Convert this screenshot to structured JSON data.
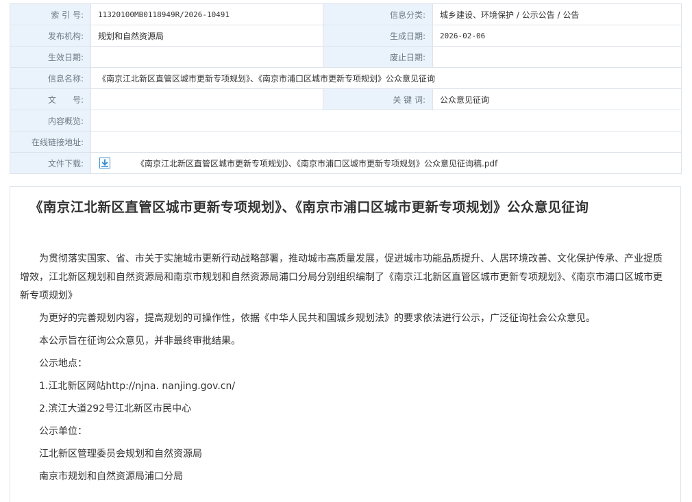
{
  "meta": {
    "index_label": "索 引 号:",
    "index_value": "11320100MB0118949R/2026-10491",
    "category_label": "信息分类:",
    "category_value": "城乡建设、环境保护 / 公示公告 / 公告",
    "publisher_label": "发布机构:",
    "publisher_value": "规划和自然资源局",
    "created_label": "生成日期:",
    "created_value": "2026-02-06",
    "effective_label": "生效日期:",
    "effective_value": "",
    "expire_label": "废止日期:",
    "expire_value": "",
    "name_label": "信息名称:",
    "name_value": "《南京江北新区直管区城市更新专项规划》、《南京市浦口区城市更新专项规划》公众意见征询",
    "docno_label": "文　　号:",
    "docno_value": "",
    "keyword_label": "关 键 词:",
    "keyword_value": "公众意见征询",
    "summary_label": "内容概览:",
    "summary_value": "",
    "online_label": "在线链接地址:",
    "online_value": "",
    "download_label": "文件下载:",
    "download_file": "《南京江北新区直管区城市更新专项规划》、《南京市浦口区城市更新专项规划》公众意见征询稿.pdf",
    "download_icon": "download-arrow-icon",
    "download_icon_color": "#3b8fd6"
  },
  "article": {
    "title": "《南京江北新区直管区城市更新专项规划》、《南京市浦口区城市更新专项规划》公众意见征询",
    "paragraphs": [
      "为贯彻落实国家、省、市关于实施城市更新行动战略部署，推动城市高质量发展，促进城市功能品质提升、人居环境改善、文化保护传承、产业提质增效，江北新区规划和自然资源局和南京市规划和自然资源局浦口分局分别组织编制了《南京江北新区直管区城市更新专项规划》、《南京市浦口区城市更新专项规划》",
      "为更好的完善规划内容，提高规划的可操作性，依据《中华人民共和国城乡规划法》的要求依法进行公示，广泛征询社会公众意见。",
      "本公示旨在征询公众意见，并非最终审批结果。",
      "公示地点：",
      "1.江北新区网站http://njna. nanjing.gov.cn/",
      "2.滨江大道292号江北新区市民中心",
      "公示单位：",
      "江北新区管理委员会规划和自然资源局",
      "南京市规划和自然资源局浦口分局"
    ]
  }
}
